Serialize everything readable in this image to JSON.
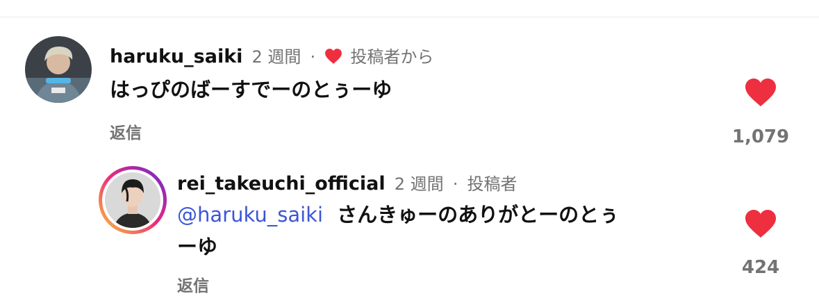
{
  "comments": [
    {
      "username": "haruku_saiki",
      "time": "2 週間",
      "separator": "·",
      "author_badge": "投稿者から",
      "text": "はっぴのばーすでーのとぅーゆ",
      "reply_label": "返信",
      "like_count": "1,079"
    }
  ],
  "reply": {
    "username": "rei_takeuchi_official",
    "time": "2 週間",
    "separator": "·",
    "author_badge": "投稿者",
    "mention": "@haruku_saiki",
    "text_line1": "さんきゅーのありがとーのとぅ",
    "text_line2": "ーゆ",
    "reply_label": "返信",
    "like_count": "424"
  },
  "colors": {
    "like_red": "#ed2f3f",
    "mention_blue": "#3b56d6",
    "meta_gray": "#737373",
    "story_ring": [
      "#f9ce34",
      "#ee2a7b",
      "#6228d7"
    ]
  }
}
